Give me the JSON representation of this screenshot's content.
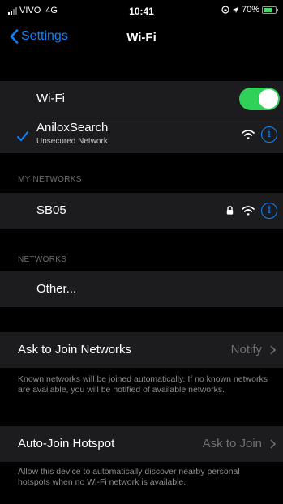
{
  "status_bar": {
    "carrier": "VIVO",
    "network": "4G",
    "time": "10:41",
    "battery": "70%",
    "battery_level": 0.7,
    "battery_color": "#4cd964"
  },
  "nav": {
    "back_label": "Settings",
    "title": "Wi-Fi"
  },
  "wifi": {
    "toggle_label": "Wi-Fi",
    "enabled": true,
    "connected_network": "AniloxSearch",
    "connected_status": "Unsecured Network"
  },
  "my_networks": {
    "header": "MY NETWORKS",
    "items": [
      {
        "name": "SB05",
        "locked": true
      }
    ]
  },
  "networks": {
    "header": "NETWORKS",
    "other_label": "Other..."
  },
  "ask_to_join": {
    "label": "Ask to Join Networks",
    "value": "Notify",
    "note": "Known networks will be joined automatically. If no known networks are available, you will be notified of available networks."
  },
  "auto_join": {
    "label": "Auto-Join Hotspot",
    "value": "Ask to Join",
    "note": "Allow this device to automatically discover nearby personal hotspots when no Wi-Fi network is available."
  },
  "colors": {
    "accent": "#0a84ff",
    "toggle_on": "#30d158",
    "cell_background": "#1c1c1e",
    "background": "#000000"
  }
}
